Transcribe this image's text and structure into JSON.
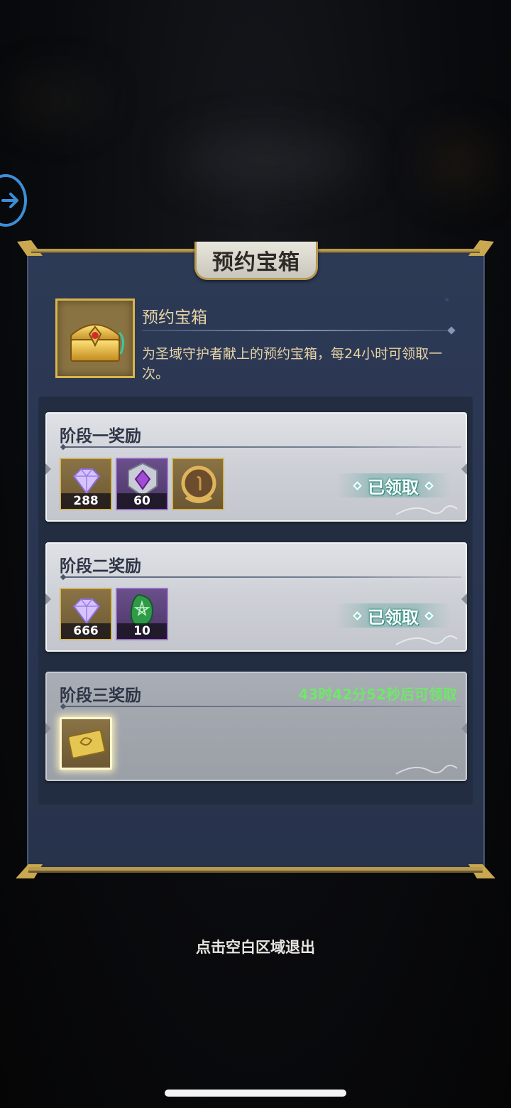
{
  "dialog": {
    "title": "预约宝箱",
    "item_name": "预约宝箱",
    "description": "为圣域守护者献上的预约宝箱，每24小时可领取一次。"
  },
  "stages": [
    {
      "title": "阶段一奖励",
      "status": "已领取",
      "rewards": [
        {
          "icon": "diamond-gem-icon",
          "qty": "288"
        },
        {
          "icon": "purple-crystal-shield-icon",
          "qty": "60"
        },
        {
          "icon": "gold-laurel-frame-icon",
          "qty": ""
        }
      ]
    },
    {
      "title": "阶段二奖励",
      "status": "已领取",
      "rewards": [
        {
          "icon": "diamond-gem-icon",
          "qty": "666"
        },
        {
          "icon": "green-rune-stone-icon",
          "qty": "10"
        }
      ]
    },
    {
      "title": "阶段三奖励",
      "status": "43时42分52秒后可领取",
      "rewards": [
        {
          "icon": "gold-card-icon",
          "qty": ""
        }
      ]
    }
  ],
  "footer": {
    "exit_hint": "点击空白区域退出"
  },
  "colors": {
    "panel": "#2d3a55",
    "gold_border": "#d3b55c",
    "countdown_green": "#6fe86a",
    "claimed_teal": "#2a8a7c",
    "side_button_blue": "#3b8fd9"
  }
}
